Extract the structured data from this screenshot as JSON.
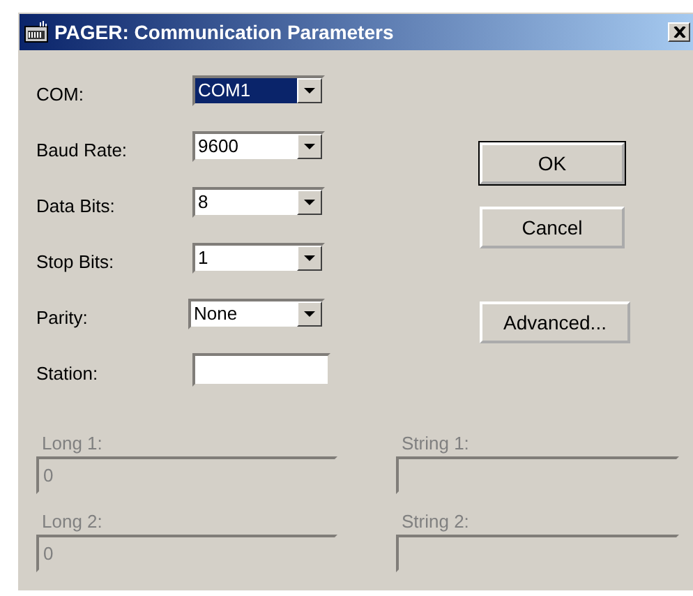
{
  "window": {
    "title": "PAGER: Communication Parameters"
  },
  "fields": [
    {
      "kind": "combo",
      "label": "COM:",
      "value": "COM1",
      "focused": true
    },
    {
      "kind": "combo",
      "label": "Baud Rate:",
      "value": "9600",
      "focused": false
    },
    {
      "kind": "combo",
      "label": "Data Bits:",
      "value": "8",
      "focused": false
    },
    {
      "kind": "combo",
      "label": "Stop Bits:",
      "value": "1",
      "focused": false
    },
    {
      "kind": "combo",
      "label": "Parity:",
      "value": "None",
      "focused": false
    },
    {
      "kind": "text",
      "label": "Station:",
      "focused": false
    }
  ],
  "buttons": [
    {
      "label": "OK",
      "default": true
    },
    {
      "label": "Cancel",
      "default": false
    },
    {
      "label": "Advanced...",
      "default": false
    }
  ],
  "extra_fields": [
    {
      "label": "Long 1:",
      "value": "0",
      "disabled": true
    },
    {
      "label": "String 1:",
      "disabled": true
    },
    {
      "label": "Long 2:",
      "value": "0",
      "disabled": true
    },
    {
      "label": "String 2:",
      "disabled": true
    }
  ]
}
